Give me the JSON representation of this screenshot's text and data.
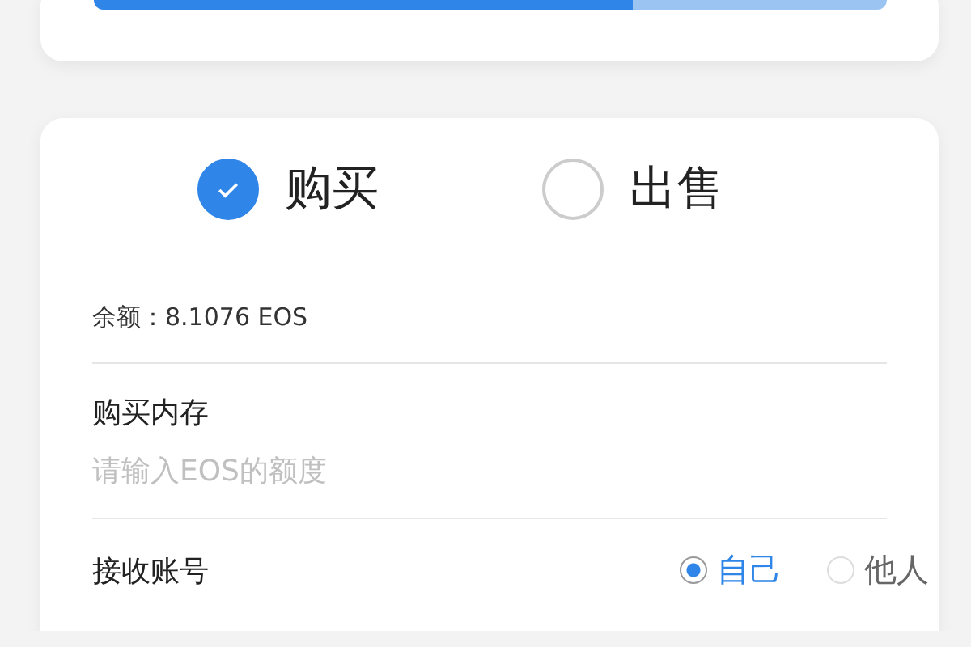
{
  "progress": {
    "level": 0.68
  },
  "trade_type": [
    {
      "label": "购买",
      "selected": true
    },
    {
      "label": "出售",
      "selected": false
    }
  ],
  "balance": "余额：8.1076 EOS",
  "memory": {
    "label": "购买内存",
    "placeholder": "请输入EOS的额度"
  },
  "receiver": {
    "label": "接收账号",
    "options": [
      {
        "label": "自己",
        "selected": true
      },
      {
        "label": "他人",
        "selected": false
      }
    ]
  }
}
